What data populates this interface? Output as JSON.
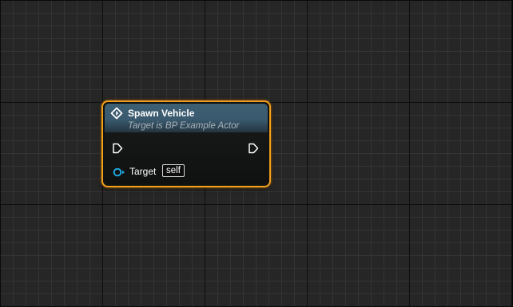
{
  "node": {
    "title": "Spawn Vehicle",
    "subtitle": "Target is BP Example Actor",
    "icon": "function-icon",
    "pins": {
      "exec_in": "exec-input-pin",
      "exec_out": "exec-output-pin",
      "target": {
        "label": "Target",
        "default_value": "self"
      }
    }
  },
  "colors": {
    "background": "#262626",
    "grid_minor": "#343434",
    "grid_major": "#0e0e0e",
    "selection_outline": "#f2a01c",
    "header": "#3e5e72",
    "object_pin": "#1ea7e0",
    "exec_pin": "#ffffff"
  }
}
